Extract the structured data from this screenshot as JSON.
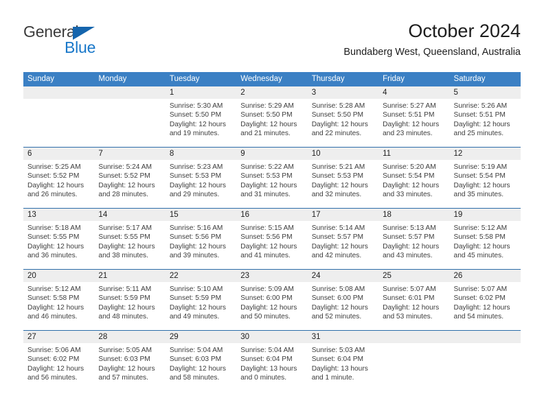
{
  "brand": {
    "line1": "General",
    "line2": "Blue",
    "triangle_color": "#1565ad",
    "blue_text_color": "#1877c9"
  },
  "header": {
    "title": "October 2024",
    "subtitle": "Bundaberg West, Queensland, Australia"
  },
  "theme": {
    "header_bar_color": "#3b80c4",
    "row_divider_color": "#2b6ca8",
    "day_number_band_color": "#eeeeee"
  },
  "weekday_headers": [
    "Sunday",
    "Monday",
    "Tuesday",
    "Wednesday",
    "Thursday",
    "Friday",
    "Saturday"
  ],
  "weeks": [
    [
      {
        "day": "",
        "sunrise": "",
        "sunset": "",
        "daylight_line1": "",
        "daylight_line2": "",
        "empty": true
      },
      {
        "day": "",
        "sunrise": "",
        "sunset": "",
        "daylight_line1": "",
        "daylight_line2": "",
        "empty": true
      },
      {
        "day": "1",
        "sunrise": "Sunrise: 5:30 AM",
        "sunset": "Sunset: 5:50 PM",
        "daylight_line1": "Daylight: 12 hours",
        "daylight_line2": "and 19 minutes."
      },
      {
        "day": "2",
        "sunrise": "Sunrise: 5:29 AM",
        "sunset": "Sunset: 5:50 PM",
        "daylight_line1": "Daylight: 12 hours",
        "daylight_line2": "and 21 minutes."
      },
      {
        "day": "3",
        "sunrise": "Sunrise: 5:28 AM",
        "sunset": "Sunset: 5:50 PM",
        "daylight_line1": "Daylight: 12 hours",
        "daylight_line2": "and 22 minutes."
      },
      {
        "day": "4",
        "sunrise": "Sunrise: 5:27 AM",
        "sunset": "Sunset: 5:51 PM",
        "daylight_line1": "Daylight: 12 hours",
        "daylight_line2": "and 23 minutes."
      },
      {
        "day": "5",
        "sunrise": "Sunrise: 5:26 AM",
        "sunset": "Sunset: 5:51 PM",
        "daylight_line1": "Daylight: 12 hours",
        "daylight_line2": "and 25 minutes."
      }
    ],
    [
      {
        "day": "6",
        "sunrise": "Sunrise: 5:25 AM",
        "sunset": "Sunset: 5:52 PM",
        "daylight_line1": "Daylight: 12 hours",
        "daylight_line2": "and 26 minutes."
      },
      {
        "day": "7",
        "sunrise": "Sunrise: 5:24 AM",
        "sunset": "Sunset: 5:52 PM",
        "daylight_line1": "Daylight: 12 hours",
        "daylight_line2": "and 28 minutes."
      },
      {
        "day": "8",
        "sunrise": "Sunrise: 5:23 AM",
        "sunset": "Sunset: 5:53 PM",
        "daylight_line1": "Daylight: 12 hours",
        "daylight_line2": "and 29 minutes."
      },
      {
        "day": "9",
        "sunrise": "Sunrise: 5:22 AM",
        "sunset": "Sunset: 5:53 PM",
        "daylight_line1": "Daylight: 12 hours",
        "daylight_line2": "and 31 minutes."
      },
      {
        "day": "10",
        "sunrise": "Sunrise: 5:21 AM",
        "sunset": "Sunset: 5:53 PM",
        "daylight_line1": "Daylight: 12 hours",
        "daylight_line2": "and 32 minutes."
      },
      {
        "day": "11",
        "sunrise": "Sunrise: 5:20 AM",
        "sunset": "Sunset: 5:54 PM",
        "daylight_line1": "Daylight: 12 hours",
        "daylight_line2": "and 33 minutes."
      },
      {
        "day": "12",
        "sunrise": "Sunrise: 5:19 AM",
        "sunset": "Sunset: 5:54 PM",
        "daylight_line1": "Daylight: 12 hours",
        "daylight_line2": "and 35 minutes."
      }
    ],
    [
      {
        "day": "13",
        "sunrise": "Sunrise: 5:18 AM",
        "sunset": "Sunset: 5:55 PM",
        "daylight_line1": "Daylight: 12 hours",
        "daylight_line2": "and 36 minutes."
      },
      {
        "day": "14",
        "sunrise": "Sunrise: 5:17 AM",
        "sunset": "Sunset: 5:55 PM",
        "daylight_line1": "Daylight: 12 hours",
        "daylight_line2": "and 38 minutes."
      },
      {
        "day": "15",
        "sunrise": "Sunrise: 5:16 AM",
        "sunset": "Sunset: 5:56 PM",
        "daylight_line1": "Daylight: 12 hours",
        "daylight_line2": "and 39 minutes."
      },
      {
        "day": "16",
        "sunrise": "Sunrise: 5:15 AM",
        "sunset": "Sunset: 5:56 PM",
        "daylight_line1": "Daylight: 12 hours",
        "daylight_line2": "and 41 minutes."
      },
      {
        "day": "17",
        "sunrise": "Sunrise: 5:14 AM",
        "sunset": "Sunset: 5:57 PM",
        "daylight_line1": "Daylight: 12 hours",
        "daylight_line2": "and 42 minutes."
      },
      {
        "day": "18",
        "sunrise": "Sunrise: 5:13 AM",
        "sunset": "Sunset: 5:57 PM",
        "daylight_line1": "Daylight: 12 hours",
        "daylight_line2": "and 43 minutes."
      },
      {
        "day": "19",
        "sunrise": "Sunrise: 5:12 AM",
        "sunset": "Sunset: 5:58 PM",
        "daylight_line1": "Daylight: 12 hours",
        "daylight_line2": "and 45 minutes."
      }
    ],
    [
      {
        "day": "20",
        "sunrise": "Sunrise: 5:12 AM",
        "sunset": "Sunset: 5:58 PM",
        "daylight_line1": "Daylight: 12 hours",
        "daylight_line2": "and 46 minutes."
      },
      {
        "day": "21",
        "sunrise": "Sunrise: 5:11 AM",
        "sunset": "Sunset: 5:59 PM",
        "daylight_line1": "Daylight: 12 hours",
        "daylight_line2": "and 48 minutes."
      },
      {
        "day": "22",
        "sunrise": "Sunrise: 5:10 AM",
        "sunset": "Sunset: 5:59 PM",
        "daylight_line1": "Daylight: 12 hours",
        "daylight_line2": "and 49 minutes."
      },
      {
        "day": "23",
        "sunrise": "Sunrise: 5:09 AM",
        "sunset": "Sunset: 6:00 PM",
        "daylight_line1": "Daylight: 12 hours",
        "daylight_line2": "and 50 minutes."
      },
      {
        "day": "24",
        "sunrise": "Sunrise: 5:08 AM",
        "sunset": "Sunset: 6:00 PM",
        "daylight_line1": "Daylight: 12 hours",
        "daylight_line2": "and 52 minutes."
      },
      {
        "day": "25",
        "sunrise": "Sunrise: 5:07 AM",
        "sunset": "Sunset: 6:01 PM",
        "daylight_line1": "Daylight: 12 hours",
        "daylight_line2": "and 53 minutes."
      },
      {
        "day": "26",
        "sunrise": "Sunrise: 5:07 AM",
        "sunset": "Sunset: 6:02 PM",
        "daylight_line1": "Daylight: 12 hours",
        "daylight_line2": "and 54 minutes."
      }
    ],
    [
      {
        "day": "27",
        "sunrise": "Sunrise: 5:06 AM",
        "sunset": "Sunset: 6:02 PM",
        "daylight_line1": "Daylight: 12 hours",
        "daylight_line2": "and 56 minutes."
      },
      {
        "day": "28",
        "sunrise": "Sunrise: 5:05 AM",
        "sunset": "Sunset: 6:03 PM",
        "daylight_line1": "Daylight: 12 hours",
        "daylight_line2": "and 57 minutes."
      },
      {
        "day": "29",
        "sunrise": "Sunrise: 5:04 AM",
        "sunset": "Sunset: 6:03 PM",
        "daylight_line1": "Daylight: 12 hours",
        "daylight_line2": "and 58 minutes."
      },
      {
        "day": "30",
        "sunrise": "Sunrise: 5:04 AM",
        "sunset": "Sunset: 6:04 PM",
        "daylight_line1": "Daylight: 13 hours",
        "daylight_line2": "and 0 minutes."
      },
      {
        "day": "31",
        "sunrise": "Sunrise: 5:03 AM",
        "sunset": "Sunset: 6:04 PM",
        "daylight_line1": "Daylight: 13 hours",
        "daylight_line2": "and 1 minute."
      },
      {
        "day": "",
        "sunrise": "",
        "sunset": "",
        "daylight_line1": "",
        "daylight_line2": "",
        "empty": true
      },
      {
        "day": "",
        "sunrise": "",
        "sunset": "",
        "daylight_line1": "",
        "daylight_line2": "",
        "empty": true
      }
    ]
  ]
}
